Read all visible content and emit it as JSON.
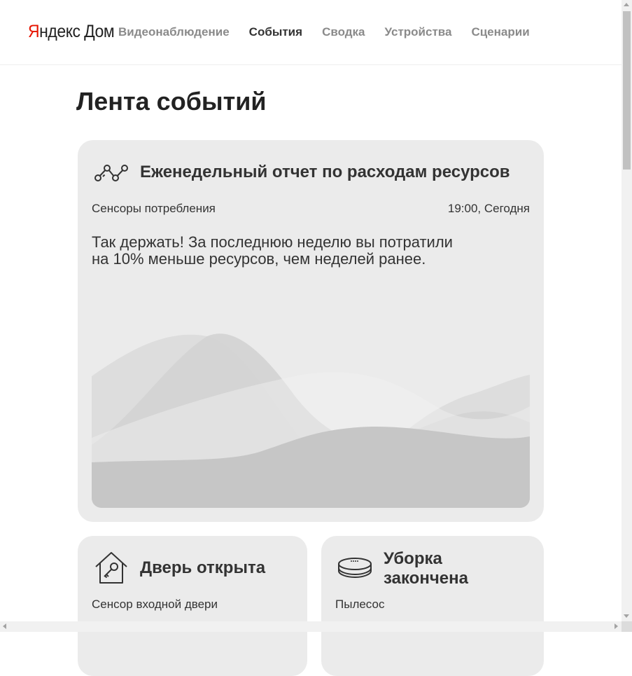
{
  "header": {
    "logo_brand": "Яндекс",
    "logo_brand_first": "Я",
    "logo_brand_rest": "ндекс",
    "logo_product": "Дом",
    "nav": [
      {
        "label": "Видеонаблюдение",
        "active": false
      },
      {
        "label": "События",
        "active": true
      },
      {
        "label": "Сводка",
        "active": false
      },
      {
        "label": "Устройства",
        "active": false
      },
      {
        "label": "Сценарии",
        "active": false
      }
    ]
  },
  "page": {
    "title": "Лента событий"
  },
  "cards": {
    "report": {
      "icon": "chart-line-icon",
      "title": "Еженедельный отчет по расходам ресурсов",
      "source": "Сенсоры потребления",
      "time": "19:00, Сегодня",
      "body_line1": "Так держать! За последнюю неделю вы потратили",
      "body_line2": "на 10% меньше ресурсов, чем неделей ранее."
    },
    "door": {
      "icon": "house-key-icon",
      "title": "Дверь открыта",
      "source": "Сенсор входной двери"
    },
    "cleaning": {
      "icon": "robot-vacuum-icon",
      "title_line1": "Уборка",
      "title_line2": "закончена",
      "source": "Пылесос"
    }
  },
  "colors": {
    "accent_red": "#e61400",
    "card_bg": "#ebebeb",
    "nav_inactive": "#8a8a8a",
    "text": "#333333"
  }
}
